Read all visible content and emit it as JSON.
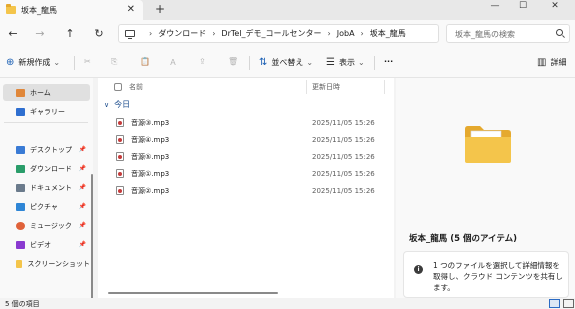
{
  "window": {
    "tab_title": "坂本_龍馬",
    "tab_close": "✕",
    "new_tab": "+",
    "minimize": "—",
    "maximize": "☐",
    "close": "✕"
  },
  "nav": {
    "back": "←",
    "forward": "→",
    "up": "↑",
    "refresh": "↻"
  },
  "breadcrumb": [
    "ダウンロード",
    "DrTel_デモ_コールセンター",
    "JobA",
    "坂本_龍馬"
  ],
  "breadcrumb_sep": "›",
  "search": {
    "placeholder": "坂本_龍馬の検索"
  },
  "commands": {
    "new_label": "新規作成",
    "new_icon": "⊕",
    "cut_icon": "✂",
    "copy_icon": "⎘",
    "paste_icon": "📋",
    "rename_icon": "Ａ",
    "share_icon": "⇪",
    "delete_icon": "🗑",
    "sort_label": "並べ替え",
    "sort_icon": "⇅",
    "view_label": "表示",
    "view_icon": "☰",
    "more_label": "···",
    "details_label": "詳細",
    "details_icon": "▥",
    "chevron": "⌄"
  },
  "sidebar": {
    "items": [
      {
        "label": "ホーム",
        "icon": "home-icon",
        "color": "#e0873a"
      },
      {
        "label": "ギャラリー",
        "icon": "gallery-icon",
        "color": "#2f6fd0"
      },
      {
        "label": "デスクトップ",
        "icon": "desktop-icon",
        "color": "#3a7bd5"
      },
      {
        "label": "ダウンロード",
        "icon": "download-icon",
        "color": "#2a9d6a"
      },
      {
        "label": "ドキュメント",
        "icon": "documents-icon",
        "color": "#6b7b8c"
      },
      {
        "label": "ピクチャ",
        "icon": "pictures-icon",
        "color": "#2f86d6"
      },
      {
        "label": "ミュージック",
        "icon": "music-icon",
        "color": "#e0623a"
      },
      {
        "label": "ビデオ",
        "icon": "videos-icon",
        "color": "#8a3ad0"
      },
      {
        "label": "スクリーンショット",
        "icon": "folder-icon",
        "color": "#f4c54b"
      }
    ],
    "pin": "📌"
  },
  "list": {
    "col_name": "名前",
    "col_date": "更新日時",
    "group": "今日",
    "group_chevron": "∨",
    "files": [
      {
        "name": "音源③.mp3",
        "date": "2025/11/05 15:26"
      },
      {
        "name": "音源④.mp3",
        "date": "2025/11/05 15:26"
      },
      {
        "name": "音源⑤.mp3",
        "date": "2025/11/05 15:26"
      },
      {
        "name": "音源①.mp3",
        "date": "2025/11/05 15:26"
      },
      {
        "name": "音源②.mp3",
        "date": "2025/11/05 15:26"
      }
    ]
  },
  "details": {
    "title": "坂本_龍馬 (5 個のアイテム)",
    "info_icon": "i",
    "info_text": "1 つのファイルを選択して詳細情報を取得し、クラウド コンテンツを共有します。"
  },
  "status": {
    "item_count": "5 個の項目"
  }
}
